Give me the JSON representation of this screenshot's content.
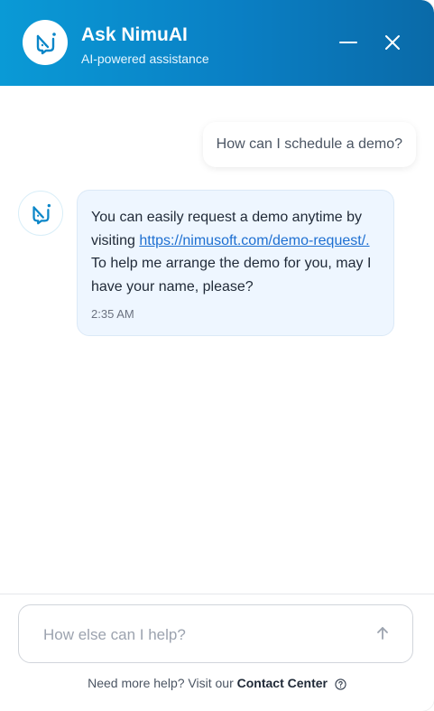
{
  "header": {
    "title": "Ask NimuAI",
    "subtitle": "AI-powered assistance",
    "logo_icon": "chat-bot-logo-icon",
    "minimize_icon": "minimize-icon",
    "close_icon": "close-icon"
  },
  "messages": {
    "user": {
      "text": "How can I schedule a demo?"
    },
    "bot": {
      "text_before_link": "You can easily request a demo anytime by visiting ",
      "link": "https://nimusoft.com/demo-request/.",
      "text_after_link": " To help me arrange the demo for you, may I have your name, please?",
      "time": "2:35 AM"
    }
  },
  "composer": {
    "placeholder": "How else can I help?",
    "send_icon": "arrow-up-icon"
  },
  "footer": {
    "help_text": "Need more help? Visit our",
    "contact_link": "Contact Center",
    "help_icon": "question-circle-icon"
  },
  "colors": {
    "header_start": "#0a9ad6",
    "header_end": "#0a6aa8",
    "bot_bubble": "#eef6ff",
    "link": "#1d6fd1"
  }
}
